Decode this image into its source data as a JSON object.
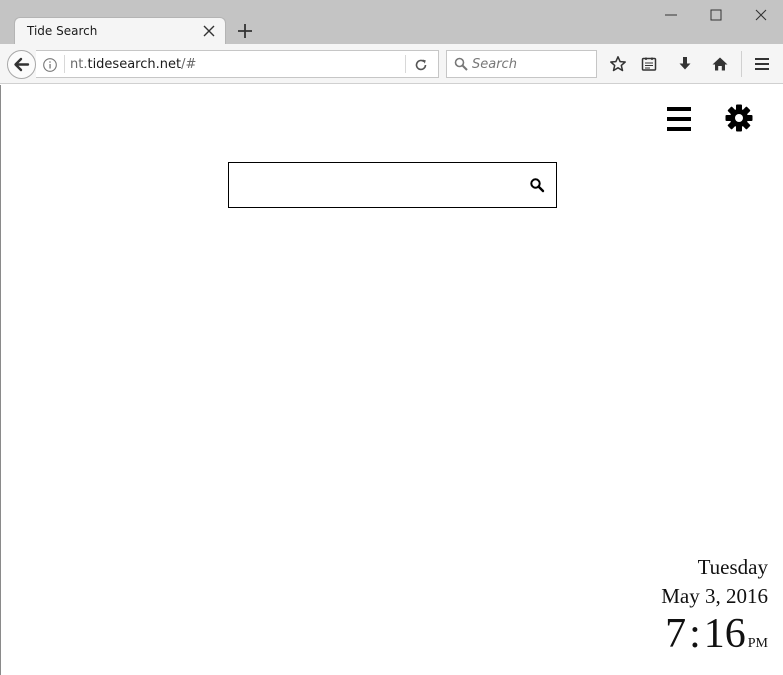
{
  "window": {
    "tab_title": "Tide Search"
  },
  "navbar": {
    "url_prefix": "nt.",
    "url_host": "tidesearch.net",
    "url_suffix": "/#",
    "search_placeholder": "Search"
  },
  "page": {
    "search_value": "",
    "clock": {
      "day": "Tuesday",
      "date": "May 3, 2016",
      "hour": "7",
      "separator": ":",
      "minute": "16",
      "ampm": "PM"
    }
  },
  "colors": {
    "titlebar": "#c4c4c4",
    "toolbar": "#f5f5f5",
    "icon": "#3d3d3d"
  },
  "icons": {
    "tab_close": "close-icon",
    "new_tab": "plus-icon",
    "back": "back-arrow-icon",
    "info": "info-icon",
    "reload": "reload-icon",
    "search": "search-icon",
    "bookmark": "star-icon",
    "reader": "reading-list-icon",
    "download": "download-icon",
    "home": "home-icon",
    "menu": "hamburger-icon",
    "settings": "gear-icon"
  }
}
